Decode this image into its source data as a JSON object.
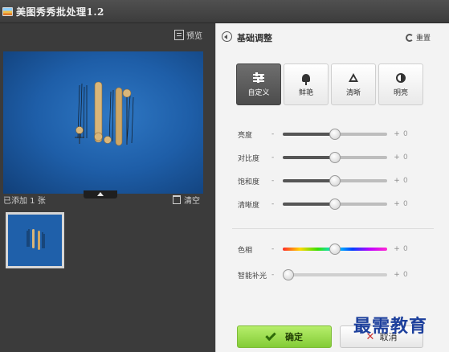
{
  "window": {
    "title": "美图秀秀批处理1.2"
  },
  "left_panel": {
    "preview_label": "预览",
    "added_count_label": "已添加 1 张",
    "clear_label": "清空"
  },
  "right_panel": {
    "title": "基础调整",
    "reset_label": "重置",
    "modes": [
      {
        "label": "自定义",
        "icon": "sliders-icon",
        "active": true
      },
      {
        "label": "鲜艳",
        "icon": "flower-icon",
        "active": false
      },
      {
        "label": "清晰",
        "icon": "triangle-icon",
        "active": false
      },
      {
        "label": "明亮",
        "icon": "half-circle-icon",
        "active": false
      }
    ],
    "sliders": [
      {
        "label": "亮度",
        "minus": "-",
        "plus": "+",
        "value": "0",
        "position": 0.5,
        "style": "default"
      },
      {
        "label": "对比度",
        "minus": "-",
        "plus": "+",
        "value": "0",
        "position": 0.5,
        "style": "default"
      },
      {
        "label": "饱和度",
        "minus": "-",
        "plus": "+",
        "value": "0",
        "position": 0.5,
        "style": "default"
      },
      {
        "label": "清晰度",
        "minus": "-",
        "plus": "+",
        "value": "0",
        "position": 0.5,
        "style": "default"
      },
      {
        "label": "色相",
        "minus": "-",
        "plus": "+",
        "value": "0",
        "position": 0.5,
        "style": "hue"
      },
      {
        "label": "智能补光",
        "minus": "-",
        "plus": "+",
        "value": "0",
        "position": 0.0,
        "style": "plain"
      }
    ],
    "confirm_label": "确定",
    "cancel_label": "取消"
  },
  "watermark": "最需教育",
  "colors": {
    "confirm_green": "#8fd43f",
    "photo_blue": "#1e5ea8",
    "watermark_blue": "#1c3f9c"
  }
}
